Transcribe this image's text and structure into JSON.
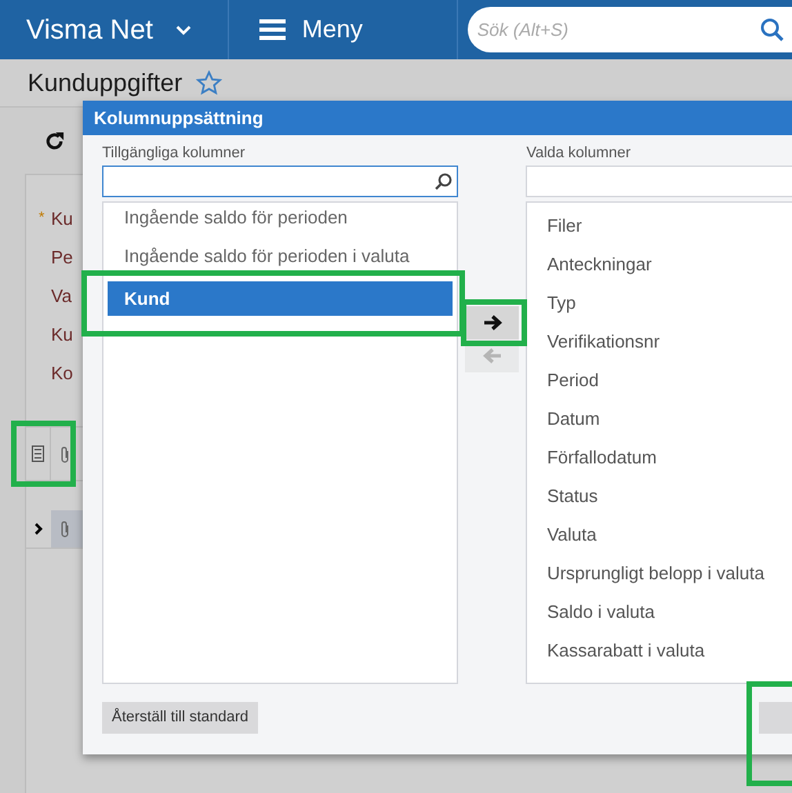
{
  "header": {
    "app_name": "Visma Net",
    "menu_label": "Meny",
    "search": {
      "placeholder": "Sök (Alt+S)"
    }
  },
  "page": {
    "title": "Kunduppgifter",
    "form_labels": [
      {
        "text": "Ku",
        "required_mark": "*"
      },
      {
        "text": "Pe"
      },
      {
        "text": "Va"
      },
      {
        "text": "Ku"
      },
      {
        "text": "Ko"
      }
    ]
  },
  "dialog": {
    "title": "Kolumnuppsättning",
    "available": {
      "label": "Tillgängliga kolumner",
      "items": [
        {
          "text": "Ingående saldo för perioden",
          "selected": false
        },
        {
          "text": "Ingående saldo för perioden i valuta",
          "selected": false
        },
        {
          "text": "Kund",
          "selected": true
        }
      ]
    },
    "move_buttons": [
      {
        "kind": "right",
        "disabled": false
      },
      {
        "kind": "left",
        "disabled": true
      }
    ],
    "chosen": {
      "label": "Valda kolumner",
      "items": [
        "Filer",
        "Anteckningar",
        "Typ",
        "Verifikationsnr",
        "Period",
        "Datum",
        "Förfallodatum",
        "Status",
        "Valuta",
        "Ursprungligt belopp i valuta",
        "Saldo i valuta",
        "Kassarabatt i valuta"
      ]
    },
    "reset_button": "Återställ till standard"
  }
}
